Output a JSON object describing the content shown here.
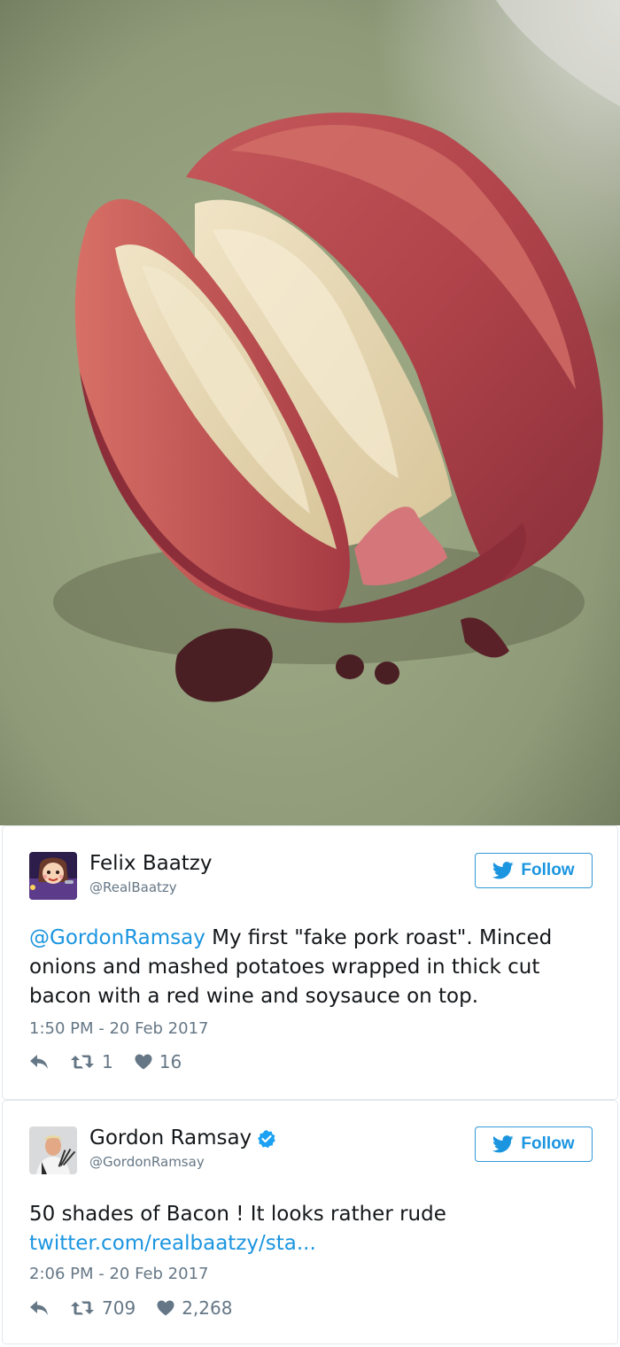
{
  "tweets": [
    {
      "display_name": "Felix Baatzy",
      "handle": "@RealBaatzy",
      "follow_label": "Follow",
      "mention": "@GordonRamsay",
      "text": " My first \"fake pork roast\". Minced onions and mashed potatoes wrapped in thick cut bacon with a red wine and soysauce on top.",
      "timestamp": "1:50 PM - 20 Feb 2017",
      "retweets": "1",
      "likes": "16"
    },
    {
      "display_name": "Gordon Ramsay",
      "handle": "@GordonRamsay",
      "follow_label": "Follow",
      "text": "50 shades of Bacon ! It looks rather rude",
      "link": "twitter.com/realbaatzy/sta...",
      "timestamp": "2:06 PM - 20 Feb 2017",
      "retweets": "709",
      "likes": "2,268",
      "verified": true
    }
  ],
  "colors": {
    "link": "#1b95e0",
    "meta": "#657786",
    "border": "#e1e8ed",
    "verified": "#1da1f2"
  },
  "icons": [
    "reply-icon",
    "retweet-icon",
    "heart-icon",
    "twitter-bird-icon",
    "verified-badge-icon"
  ]
}
